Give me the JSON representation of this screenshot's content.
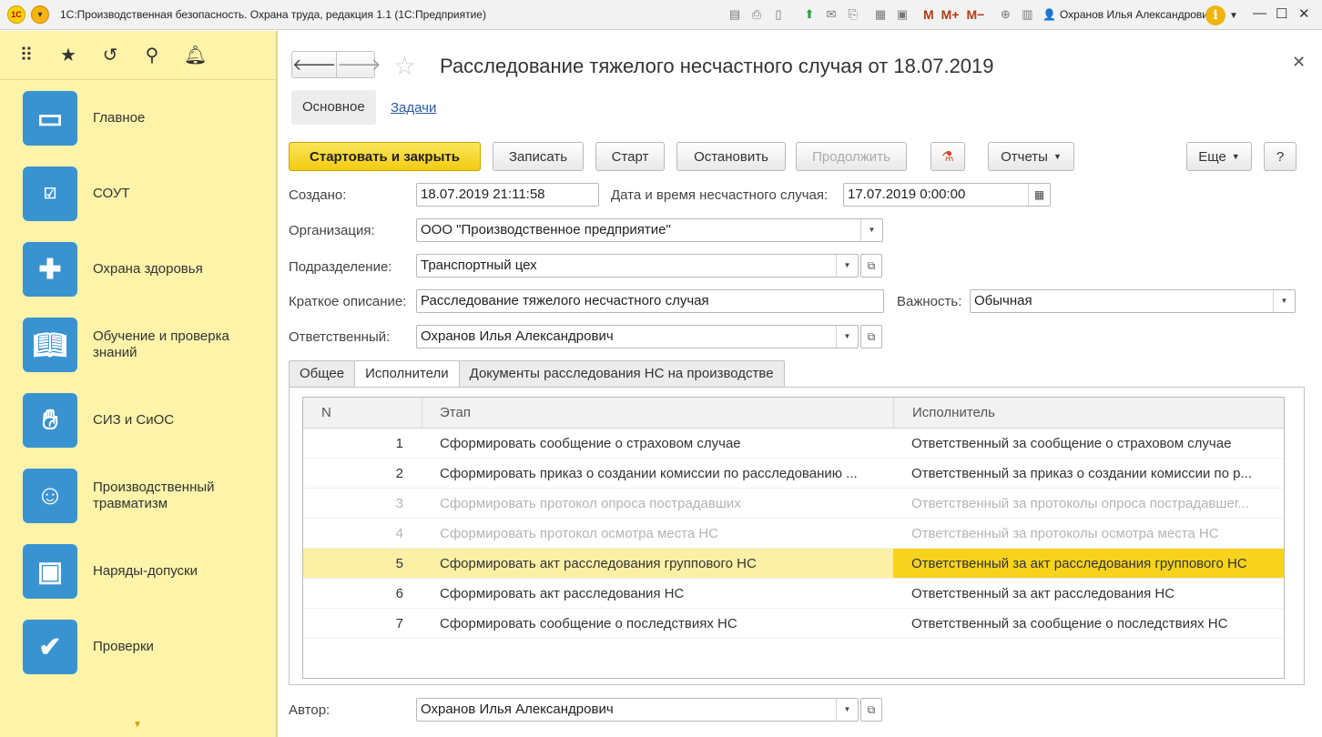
{
  "window": {
    "title": "1С:Производственная безопасность. Охрана труда, редакция 1.1  (1С:Предприятие)",
    "user": "Охранов Илья Александрович",
    "toolbar_m": [
      "M",
      "M+",
      "M−"
    ]
  },
  "sidebar": {
    "items": [
      {
        "label": "Главное",
        "icon": "monitor-search-icon"
      },
      {
        "label": "СОУТ",
        "icon": "checklist-icon"
      },
      {
        "label": "Охрана здоровья",
        "icon": "medical-cross-icon"
      },
      {
        "label": "Обучение и проверка знаний",
        "icon": "book-hand-icon"
      },
      {
        "label": "СИЗ и СиОС",
        "icon": "glove-icon"
      },
      {
        "label": "Производственный травматизм",
        "icon": "injured-person-icon"
      },
      {
        "label": "Наряды-допуски",
        "icon": "permit-badge-icon"
      },
      {
        "label": "Проверки",
        "icon": "clipboard-check-icon"
      }
    ]
  },
  "document": {
    "title": "Расследование тяжелого несчастного случая от 18.07.2019",
    "tabs": [
      "Основное",
      "Задачи"
    ]
  },
  "toolbar": {
    "start_close": "Стартовать и закрыть",
    "save": "Записать",
    "start": "Старт",
    "stop": "Остановить",
    "continue": "Продолжить",
    "reports": "Отчеты",
    "more": "Еще",
    "help": "?"
  },
  "form": {
    "created_label": "Создано:",
    "created_value": "18.07.2019 21:11:58",
    "accident_date_label": "Дата и время несчастного случая:",
    "accident_date_value": "17.07.2019  0:00:00",
    "org_label": "Организация:",
    "org_value": "ООО \"Производственное предприятие\"",
    "dept_label": "Подразделение:",
    "dept_value": "Транспортный цех",
    "desc_label": "Краткое описание:",
    "desc_value": "Расследование тяжелого несчастного случая",
    "importance_label": "Важность:",
    "importance_value": "Обычная",
    "responsible_label": "Ответственный:",
    "responsible_value": "Охранов Илья Александрович",
    "author_label": "Автор:",
    "author_value": "Охранов Илья Александрович"
  },
  "subtabs": [
    "Общее",
    "Исполнители",
    "Документы расследования НС на производстве"
  ],
  "table": {
    "headers": [
      "N",
      "Этап",
      "Исполнитель"
    ],
    "rows": [
      {
        "n": "1",
        "stage": "Сформировать сообщение о страховом случае",
        "executor": "Ответственный за сообщение о страховом случае"
      },
      {
        "n": "2",
        "stage": "Сформировать приказ о создании комиссии по расследованию ...",
        "executor": "Ответственный за приказ о создании комиссии по р..."
      },
      {
        "n": "3",
        "stage": "Сформировать протокол опроса пострадавших",
        "executor": "Ответственный за протоколы опроса пострадавшег..."
      },
      {
        "n": "4",
        "stage": "Сформировать протокол осмотра места НС",
        "executor": "Ответственный за протоколы осмотра места НС"
      },
      {
        "n": "5",
        "stage": "Сформировать акт расследования группового НС",
        "executor": "Ответственный за акт расследования группового НС"
      },
      {
        "n": "6",
        "stage": "Сформировать акт расследования НС",
        "executor": "Ответственный за акт расследования НС"
      },
      {
        "n": "7",
        "stage": "Сформировать сообщение о последствиях НС",
        "executor": "Ответственный за сообщение о последствиях НС"
      }
    ]
  }
}
